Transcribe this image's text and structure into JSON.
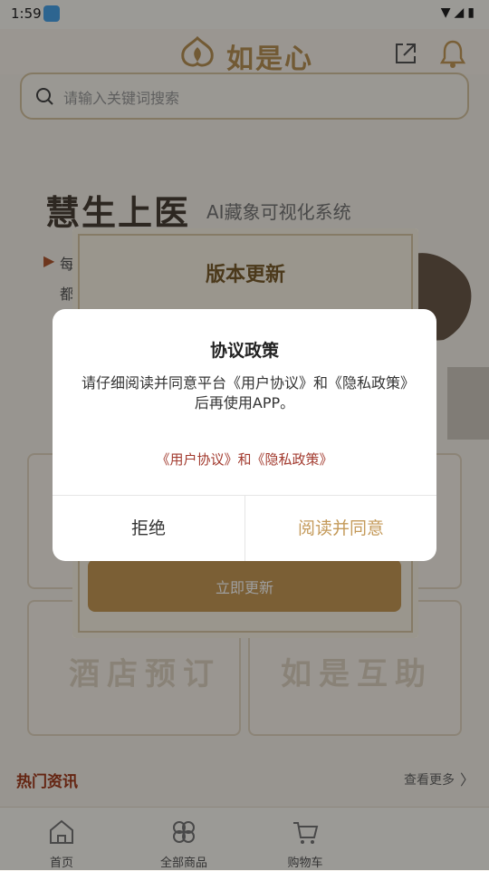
{
  "status_bar": {
    "time": "1:59",
    "icons": "▼◢▮"
  },
  "header": {
    "logo_text": "如是心"
  },
  "search": {
    "placeholder": "请输入关键词搜索"
  },
  "hero": {
    "title": "慧生上医",
    "subtitle": "AI藏象可视化系统",
    "line1": "每",
    "line2": "都"
  },
  "tiles": [
    {
      "label": ""
    },
    {
      "label": ""
    },
    {
      "label": "酒店预订"
    },
    {
      "label": "如是互助"
    }
  ],
  "news": {
    "title": "热门资讯",
    "more": "查看更多",
    "chevron": "〉"
  },
  "bottom_nav": [
    {
      "label": "首页"
    },
    {
      "label": "全部商品"
    },
    {
      "label": "购物车"
    }
  ],
  "update_dialog": {
    "title": "版本更新",
    "button": "立即更新"
  },
  "policy_dialog": {
    "title": "协议政策",
    "body": "请仔细阅读并同意平台《用户协议》和《隐私政策》后再使用APP。",
    "link_user": "《用户协议》",
    "link_and": "和",
    "link_privacy": "《隐私政策》",
    "reject": "拒绝",
    "accept": "阅读并同意"
  },
  "colors": {
    "accent_gold": "#c49a5a",
    "link_red": "#a23a2e",
    "brand_gold": "#b99155"
  }
}
